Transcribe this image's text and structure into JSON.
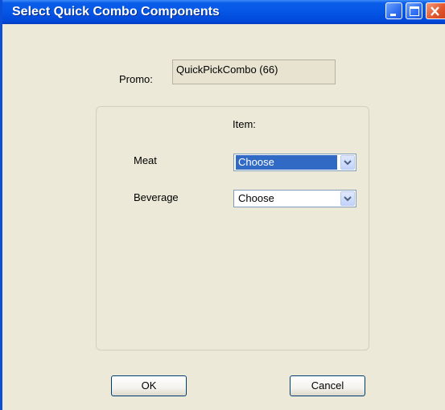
{
  "window": {
    "title": "Select Quick Combo Components",
    "controls": {
      "minimize": "minimize",
      "maximize": "maximize",
      "close": "close"
    }
  },
  "promo": {
    "label": "Promo:",
    "value": "QuickPickCombo (66)"
  },
  "components": {
    "header": "Item:",
    "rows": [
      {
        "label": "Meat",
        "selected": "Choose",
        "focused": true
      },
      {
        "label": "Beverage",
        "selected": "Choose",
        "focused": false
      }
    ]
  },
  "buttons": {
    "ok": "OK",
    "cancel": "Cancel"
  },
  "colors": {
    "titlebar": "#0556e6",
    "window_bg": "#ece9d8",
    "selection": "#316ac5",
    "close_button": "#e2562e"
  }
}
